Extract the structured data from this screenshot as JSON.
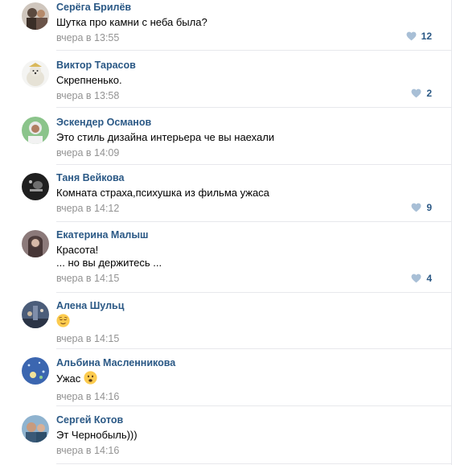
{
  "comments": [
    {
      "author": "Серёга Брилёв",
      "lines": [
        "Шутка про камни с неба была?"
      ],
      "date": "вчера в 13:55",
      "likes": "12",
      "avatar_color": "#5b4a3f"
    },
    {
      "author": "Виктор Тарасов",
      "lines": [
        "Скрепненько."
      ],
      "date": "вчера в 13:58",
      "likes": "2",
      "avatar_color": "#e8e4d8"
    },
    {
      "author": "Эскендер Османов",
      "lines": [
        "Это стиль дизайна интерьера че вы наехали"
      ],
      "date": "вчера в 14:09",
      "likes": "",
      "avatar_color": "#6aa56a"
    },
    {
      "author": "Таня Вейкова",
      "lines": [
        "Комната страха,психушка из фильма ужаса"
      ],
      "date": "вчера в 14:12",
      "likes": "9",
      "avatar_color": "#2b2b2b"
    },
    {
      "author": "Екатерина Малыш",
      "lines": [
        "Красота!",
        "... но вы держитесь ..."
      ],
      "date": "вчера в 14:15",
      "likes": "4",
      "avatar_color": "#6b5a5a"
    },
    {
      "author": "Алена Шульц",
      "lines": [
        ""
      ],
      "emoji": "relieved-face-emoji",
      "date": "вчера в 14:15",
      "likes": "",
      "avatar_color": "#3d4a63"
    },
    {
      "author": "Альбина Масленникова",
      "lines": [
        "Ужас "
      ],
      "emoji": "frowning-face-emoji",
      "date": "вчера в 14:16",
      "likes": "",
      "avatar_color": "#3b66b0"
    },
    {
      "author": "Сергей Котов",
      "lines": [
        "Эт Чернобыль)))"
      ],
      "date": "вчера в 14:16",
      "likes": "",
      "avatar_color": "#5c87a8"
    }
  ],
  "colors": {
    "author": "#2a5885",
    "date": "#939393",
    "like_heart": "#a8bfd6",
    "separator": "#e7e8ec"
  }
}
